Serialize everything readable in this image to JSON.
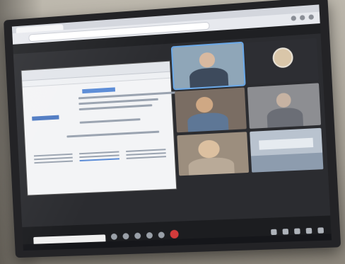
{
  "meeting": {
    "window_title": "",
    "top_bar_label": "",
    "search_placeholder": "",
    "room_label": ""
  },
  "participants": [
    {
      "name": "",
      "kind": "video",
      "active": true
    },
    {
      "name": "",
      "kind": "avatar",
      "active": false
    },
    {
      "name": "",
      "kind": "video",
      "active": false
    },
    {
      "name": "",
      "kind": "video",
      "active": false
    },
    {
      "name": "",
      "kind": "video",
      "active": false
    },
    {
      "name": "",
      "kind": "video",
      "active": false
    }
  ],
  "shared_document": {
    "column_headings": [
      "",
      "",
      ""
    ]
  },
  "colors": {
    "accent": "#6aa8e8",
    "leave_button": "#d23b3b",
    "shared_highlight": "#5a8bd6"
  }
}
